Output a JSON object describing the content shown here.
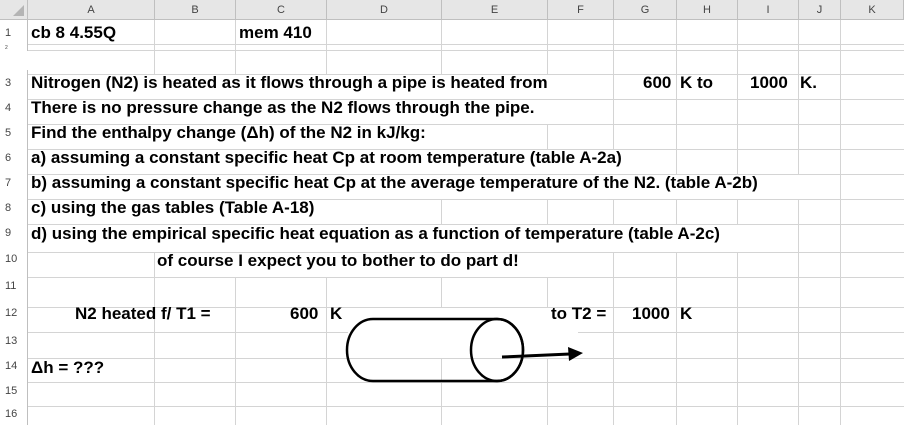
{
  "spreadsheet": {
    "columns": [
      "A",
      "B",
      "C",
      "D",
      "E",
      "F",
      "G",
      "H",
      "I",
      "J",
      "K"
    ],
    "rows": [
      "1",
      "2",
      "3",
      "4",
      "5",
      "6",
      "7",
      "8",
      "9",
      "10",
      "11",
      "12",
      "13",
      "14",
      "15",
      "16"
    ]
  },
  "cells": {
    "a1": "cb 8 4.55Q",
    "c1": "mem 410",
    "a3": "Nitrogen (N2) is heated as it flows through a pipe is heated from",
    "g3": "600",
    "h3": "K to",
    "i3": "1000",
    "j3": "K.",
    "a4": "There is no pressure change as the N2 flows through the pipe.",
    "a5": "Find the enthalpy change (Δh) of the N2 in kJ/kg:",
    "a6": "a) assuming a constant specific heat Cp at room temperature (table A-2a)",
    "a7": "b) assuming a constant specific heat Cp at the average temperature of the N2. (table A-2b)",
    "a8": "c) using the gas tables (Table A-18)",
    "a9": "d) using the empirical specific heat equation as a function of temperature (table A-2c)",
    "b10": "of course I expect you to bother to do part d!",
    "a12": "N2 heated f/ T1 =",
    "c12": "600",
    "d12": "K",
    "f12": "to T2 =",
    "g12": "1000",
    "h12": "K",
    "a14": "Δh = ???"
  }
}
